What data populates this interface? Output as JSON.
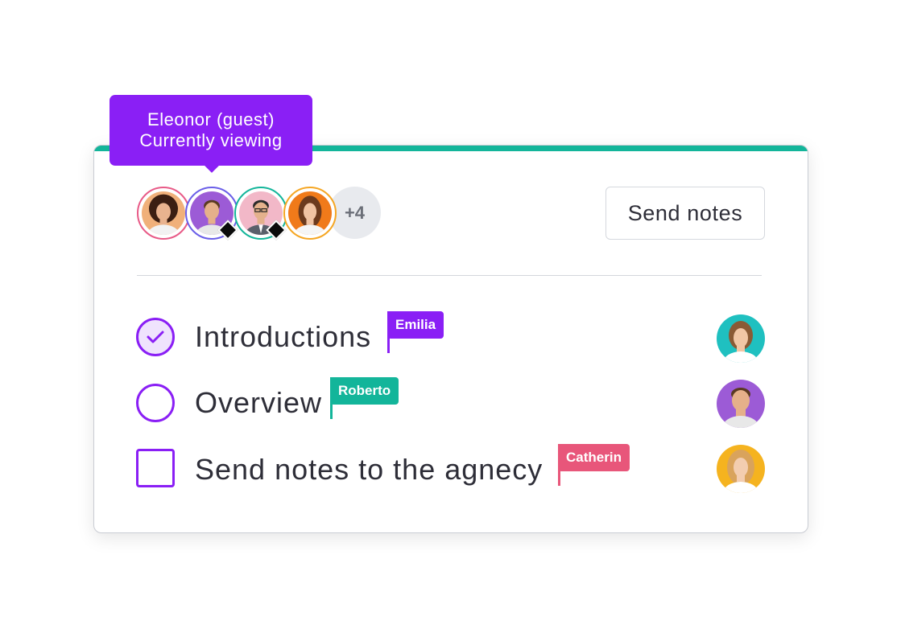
{
  "tooltip": {
    "line1": "Eleonor (guest)",
    "line2": "Currently viewing",
    "color": "#8a1ff5"
  },
  "card": {
    "accent_color": "#13b59a"
  },
  "participants": [
    {
      "name": "avatar-woman-curly-hair",
      "ring_color": "#e85a87",
      "bg": "#f0b07a"
    },
    {
      "name": "avatar-man-purple-bg",
      "ring_color": "#6a5ee8",
      "bg": "#9c5bd6",
      "badge": "diamond-icon"
    },
    {
      "name": "avatar-man-glasses",
      "ring_color": "#13b59a",
      "bg": "#f2b8c8",
      "badge": "diamond-icon"
    },
    {
      "name": "avatar-woman-orange-bg",
      "ring_color": "#f5a623",
      "bg": "#f07a1a"
    }
  ],
  "more_participants": "+4",
  "send_notes_label": "Send notes",
  "tasks": [
    {
      "label": "Introductions",
      "status": "done",
      "check_shape": "circle",
      "owner": "Emilia",
      "owner_color": "#8a1ff5",
      "assignee_bg": "#1fc0c0"
    },
    {
      "label": "Overview",
      "status": "open",
      "check_shape": "circle",
      "owner": "Roberto",
      "owner_color": "#13b59a",
      "assignee_bg": "#9c5bd6"
    },
    {
      "label": "Send notes to the agnecy",
      "status": "open",
      "check_shape": "square",
      "owner": "Catherin",
      "owner_color": "#e8567a",
      "assignee_bg": "#f5b31f"
    }
  ]
}
